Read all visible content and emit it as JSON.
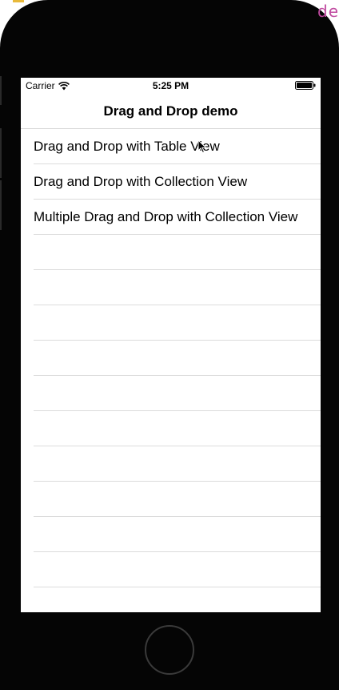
{
  "status_bar": {
    "carrier": "Carrier",
    "time": "5:25 PM"
  },
  "nav_bar": {
    "title": "Drag and Drop demo"
  },
  "table": {
    "rows": [
      {
        "label": "Drag and Drop with Table View"
      },
      {
        "label": "Drag and Drop with Collection View"
      },
      {
        "label": "Multiple Drag and Drop with Collection View"
      }
    ],
    "empty_rows": 10
  },
  "background_peek_text": "de",
  "colors": {
    "device_frame": "#050505",
    "separator": "#dcdcdc",
    "background_accent": "#c04aa0"
  }
}
